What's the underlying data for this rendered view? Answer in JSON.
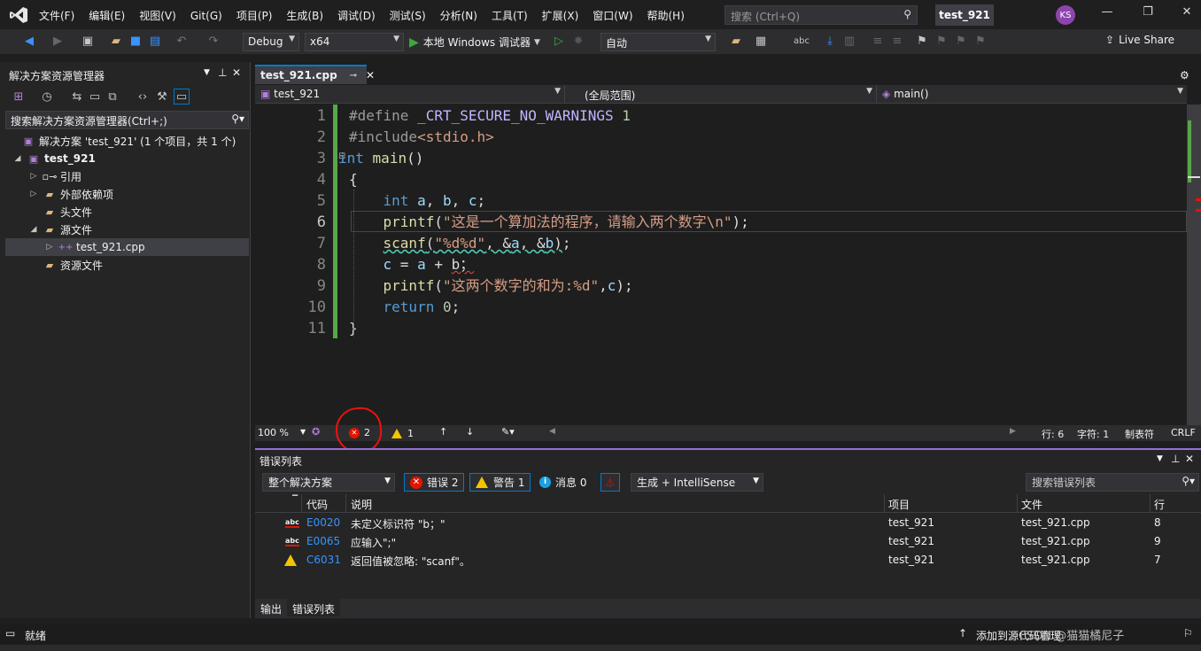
{
  "menu": [
    "文件(F)",
    "编辑(E)",
    "视图(V)",
    "Git(G)",
    "项目(P)",
    "生成(B)",
    "调试(D)",
    "测试(S)",
    "分析(N)",
    "工具(T)",
    "扩展(X)",
    "窗口(W)",
    "帮助(H)"
  ],
  "search": {
    "placeholder": "搜索 (Ctrl+Q)"
  },
  "project_badge": "test_921",
  "user_initials": "KS",
  "toolbar": {
    "config": "Debug",
    "platform": "x64",
    "run_label": "本地 Windows 调试器",
    "auto": "自动",
    "live_share": "Live Share"
  },
  "solution_explorer": {
    "title": "解决方案资源管理器",
    "search": "搜索解决方案资源管理器(Ctrl+;)",
    "items": [
      {
        "label": "解决方案 'test_921' (1 个项目，共 1 个)"
      },
      {
        "label": "test_921"
      },
      {
        "label": "引用"
      },
      {
        "label": "外部依赖项"
      },
      {
        "label": "头文件"
      },
      {
        "label": "源文件"
      },
      {
        "label": "test_921.cpp"
      },
      {
        "label": "资源文件"
      }
    ]
  },
  "editor": {
    "tab": "test_921.cpp",
    "nav_file": "test_921",
    "nav_scope": "(全局范围)",
    "nav_member": "main()",
    "line_numbers": [
      "1",
      "2",
      "3",
      "4",
      "5",
      "6",
      "7",
      "8",
      "9",
      "10",
      "11"
    ],
    "zoom": "100 %",
    "error_count": "2",
    "warning_count": "1",
    "row": "行: 6",
    "col": "字符: 1",
    "indent": "制表符",
    "eol": "CRLF"
  },
  "error_list": {
    "title": "错误列表",
    "scope": "整个解决方案",
    "errors_btn": "错误 2",
    "warnings_btn": "警告 1",
    "messages_btn": "消息 0",
    "build_filter": "生成 + IntelliSense",
    "search": "搜索错误列表",
    "headers": {
      "code": "代码",
      "desc": "说明",
      "project": "项目",
      "file": "文件",
      "line": "行"
    },
    "rows": [
      {
        "type": "error",
        "code": "E0020",
        "desc": "未定义标识符 \"b；\"",
        "project": "test_921",
        "file": "test_921.cpp",
        "line": "8"
      },
      {
        "type": "error",
        "code": "E0065",
        "desc": "应输入\";\"",
        "project": "test_921",
        "file": "test_921.cpp",
        "line": "9"
      },
      {
        "type": "warning",
        "code": "C6031",
        "desc": "返回值被忽略: \"scanf\"。",
        "project": "test_921",
        "file": "test_921.cpp",
        "line": "7"
      }
    ]
  },
  "bottom_tabs": {
    "output": "输出",
    "errlist": "错误列表"
  },
  "statusbar": {
    "ready": "就绪",
    "add_source": "添加到源代码管理",
    "watermark": "CSDN @猫猫橘尼子"
  }
}
